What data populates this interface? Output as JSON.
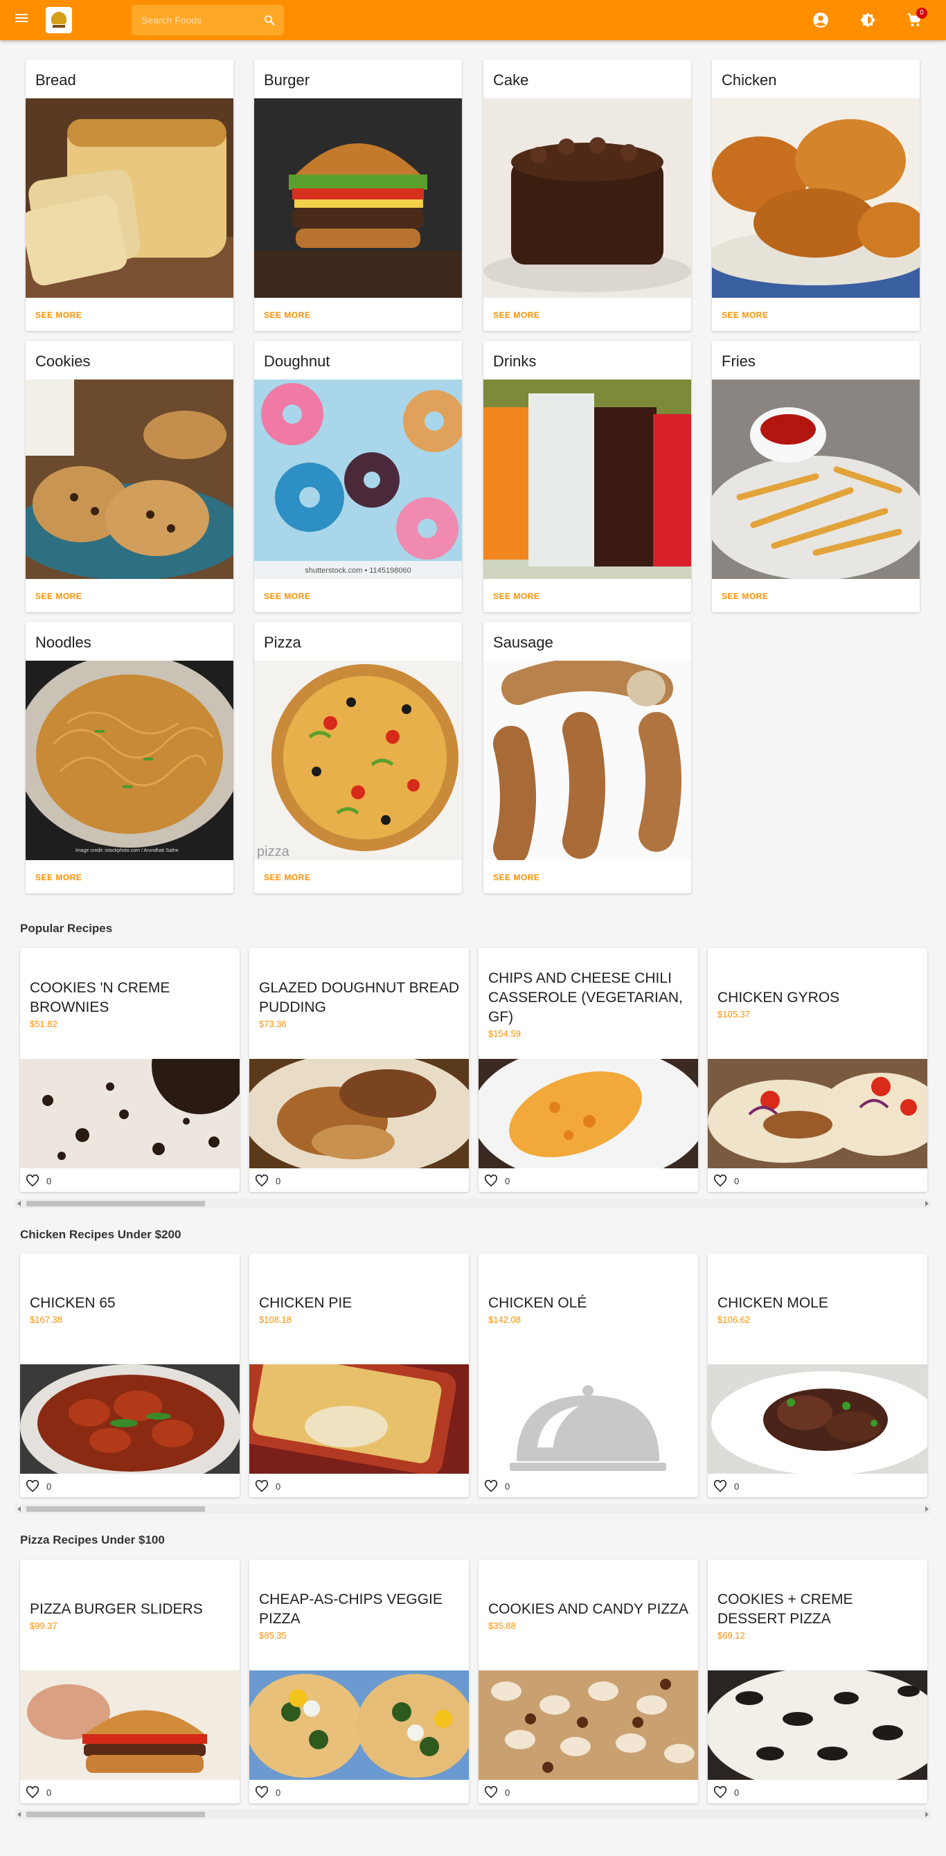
{
  "header": {
    "search_placeholder": "Search Foods",
    "cart_count": "0",
    "accent": "#ff8f00"
  },
  "categories": [
    {
      "name": "Bread",
      "see_more": "SEE MORE"
    },
    {
      "name": "Burger",
      "see_more": "SEE MORE"
    },
    {
      "name": "Cake",
      "see_more": "SEE MORE"
    },
    {
      "name": "Chicken",
      "see_more": "SEE MORE"
    },
    {
      "name": "Cookies",
      "see_more": "SEE MORE"
    },
    {
      "name": "Doughnut",
      "see_more": "SEE MORE"
    },
    {
      "name": "Drinks",
      "see_more": "SEE MORE"
    },
    {
      "name": "Fries",
      "see_more": "SEE MORE"
    },
    {
      "name": "Noodles",
      "see_more": "SEE MORE"
    },
    {
      "name": "Pizza",
      "see_more": "SEE MORE"
    },
    {
      "name": "Sausage",
      "see_more": "SEE MORE"
    }
  ],
  "image_text": {
    "doughnut_watermark": "shutterstock.com • 1145198060",
    "noodles_credit": "Image credit: istockphoto.com / Arundhati Sathe",
    "pizza_watermark": "pizza"
  },
  "sections": [
    {
      "title": "Popular Recipes",
      "recipes": [
        {
          "name": "COOKIES 'N CREME BROWNIES",
          "price": "$51.82",
          "likes": "0"
        },
        {
          "name": "GLAZED DOUGHNUT BREAD PUDDING",
          "price": "$73.36",
          "likes": "0"
        },
        {
          "name": "CHIPS AND CHEESE CHILI CASSEROLE (VEGETARIAN, GF)",
          "price": "$154.59",
          "likes": "0"
        },
        {
          "name": "CHICKEN GYROS",
          "price": "$105.37",
          "likes": "0"
        }
      ]
    },
    {
      "title": "Chicken Recipes Under $200",
      "recipes": [
        {
          "name": "CHICKEN 65",
          "price": "$167.38",
          "likes": "0"
        },
        {
          "name": "CHICKEN PIE",
          "price": "$108.18",
          "likes": "0"
        },
        {
          "name": "CHICKEN OLÉ",
          "price": "$142.08",
          "likes": "0"
        },
        {
          "name": "CHICKEN MOLE",
          "price": "$106.62",
          "likes": "0"
        }
      ]
    },
    {
      "title": "Pizza Recipes Under $100",
      "recipes": [
        {
          "name": "PIZZA BURGER SLIDERS",
          "price": "$99.37",
          "likes": "0"
        },
        {
          "name": "CHEAP-AS-CHIPS VEGGIE PIZZA",
          "price": "$85.35",
          "likes": "0"
        },
        {
          "name": "COOKIES AND CANDY PIZZA",
          "price": "$35.88",
          "likes": "0"
        },
        {
          "name": "COOKIES + CREME DESSERT PIZZA",
          "price": "$69.12",
          "likes": "0"
        }
      ]
    }
  ]
}
